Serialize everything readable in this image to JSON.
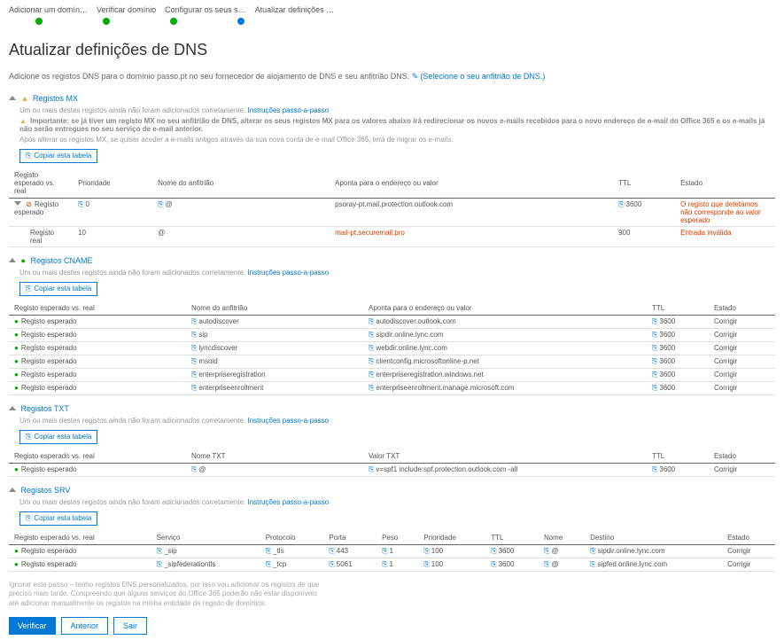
{
  "steps": {
    "s1": "Adicionar um domín…",
    "s2": "Verificar domínio",
    "s3": "Configurar os seus s…",
    "s4": "Atualizar definições …"
  },
  "pageTitle": "Atualizar definições de DNS",
  "intro": {
    "text": "Adicione os registos DNS para o domínio passo.pt no seu fornecedor de alojamento de DNS e seu anfitrião DNS.",
    "linkText": "(Selecione o seu anfitrião de DNS.)"
  },
  "mx": {
    "title": "Registos MX",
    "note": "Um ou mais destes registos ainda não foram adicionados corretamente.",
    "noteLink": "Instruções passo-a-passo",
    "important": "Importante: se já tiver um registo MX no seu anfitrião de DNS, alterar os seus registos MX para os valores abaixo irá redirecionar os novos e-mails recebidos para o novo endereço de e-mail do Office 365 e os e-mails já não serão entregues no seu serviço de e-mail anterior.",
    "afterNote": "Após alterar os registos MX, se quiser aceder a e-mails antigos através da sua nova conta de e-mail Office 365, terá de migrar os e-mails.",
    "copyBtn": "Copiar esta tabela",
    "headers": {
      "c1": "Registo esperado vs. real",
      "c2": "Prioridade",
      "c3": "Nome do anfitrião",
      "c4": "Aponta para o endereço ou valor",
      "c5": "TTL",
      "c6": "Estado"
    },
    "rows": [
      {
        "status": "bad",
        "label": "Registo esperado",
        "prio": "0",
        "host": "@",
        "target": "psoray-pt.mail.protection.outlook.com",
        "ttl": "3600",
        "state": "O registo que detetámos não corresponde ao valor esperado",
        "stateClass": "red"
      },
      {
        "status": "",
        "label": "Registo real",
        "prio": "10",
        "host": "@",
        "target": "mail-pt.securemail.pro",
        "ttl": "900",
        "state": "Entrada inválida",
        "stateClass": "red",
        "targetClass": "red"
      }
    ]
  },
  "cname": {
    "title": "Registos CNAME",
    "note": "Um ou mais destes registos ainda não foram adicionados corretamente.",
    "noteLink": "Instruções passo-a-passo",
    "copyBtn": "Copiar esta tabela",
    "headers": {
      "c1": "Registo esperado vs. real",
      "c2": "Nome do anfitrião",
      "c3": "Aponta para o endereço ou valor",
      "c4": "TTL",
      "c5": "Estado"
    },
    "rows": [
      {
        "label": "Registo esperado",
        "host": "autodiscover",
        "target": "autodiscover.outlook.com",
        "ttl": "3600",
        "state": "Corrigir"
      },
      {
        "label": "Registo esperado",
        "host": "sip",
        "target": "sipdir.online.lync.com",
        "ttl": "3600",
        "state": "Corrigir"
      },
      {
        "label": "Registo esperado",
        "host": "lyncdiscover",
        "target": "webdir.online.lync.com",
        "ttl": "3600",
        "state": "Corrigir"
      },
      {
        "label": "Registo esperado",
        "host": "msoid",
        "target": "clientconfig.microsoftonline-p.net",
        "ttl": "3600",
        "state": "Corrigir"
      },
      {
        "label": "Registo esperado",
        "host": "enterpriseregistration",
        "target": "enterpriseregistration.windows.net",
        "ttl": "3600",
        "state": "Corrigir"
      },
      {
        "label": "Registo esperado",
        "host": "enterpriseenrollment",
        "target": "enterpriseenrollment.manage.microsoft.com",
        "ttl": "3600",
        "state": "Corrigir"
      }
    ]
  },
  "txt": {
    "title": "Registos TXT",
    "note": "Um ou mais destes registos ainda não foram adicionados corretamente.",
    "noteLink": "Instruções passo-a-passo",
    "copyBtn": "Copiar esta tabela",
    "headers": {
      "c1": "Registo esperado vs. real",
      "c2": "Nome TXT",
      "c3": "Valor TXT",
      "c4": "TTL",
      "c5": "Estado"
    },
    "rows": [
      {
        "label": "Registo esperado",
        "host": "@",
        "target": "v=spf1 include:spf.protection.outlook.com -all",
        "ttl": "3600",
        "state": "Corrigir"
      }
    ]
  },
  "srv": {
    "title": "Registos SRV",
    "note": "Um ou mais destes registos ainda não foram adicionados corretamente.",
    "noteLink": "Instruções passo-a-passo",
    "copyBtn": "Copiar esta tabela",
    "headers": {
      "c1": "Registo esperado vs. real",
      "c2": "Serviço",
      "c3": "Protocolo",
      "c4": "Porta",
      "c5": "Peso",
      "c6": "Prioridade",
      "c7": "TTL",
      "c8": "Nome",
      "c9": "Destino",
      "c10": "Estado"
    },
    "rows": [
      {
        "label": "Registo esperado",
        "service": "_sip",
        "proto": "_tls",
        "port": "443",
        "weight": "1",
        "prio": "100",
        "ttl": "3600",
        "name": "@",
        "dest": "sipdir.online.lync.com",
        "state": "Corrigir"
      },
      {
        "label": "Registo esperado",
        "service": "_sipfederationtls",
        "proto": "_tcp",
        "port": "5061",
        "weight": "1",
        "prio": "100",
        "ttl": "3600",
        "name": "@",
        "dest": "sipfed.online.lync.com",
        "state": "Corrigir"
      }
    ]
  },
  "bottomNote": "Ignorar este passo – tenho registos DNS personalizados, por isso vou adicionar os registos de que preciso mais tarde. Compreendo que alguns serviços do Office 365 poderão não estar disponíveis até adicionar manualmente os registos na minha entidade de registo de domínios.",
  "buttons": {
    "verify": "Verificar",
    "back": "Anterior",
    "exit": "Sair"
  }
}
